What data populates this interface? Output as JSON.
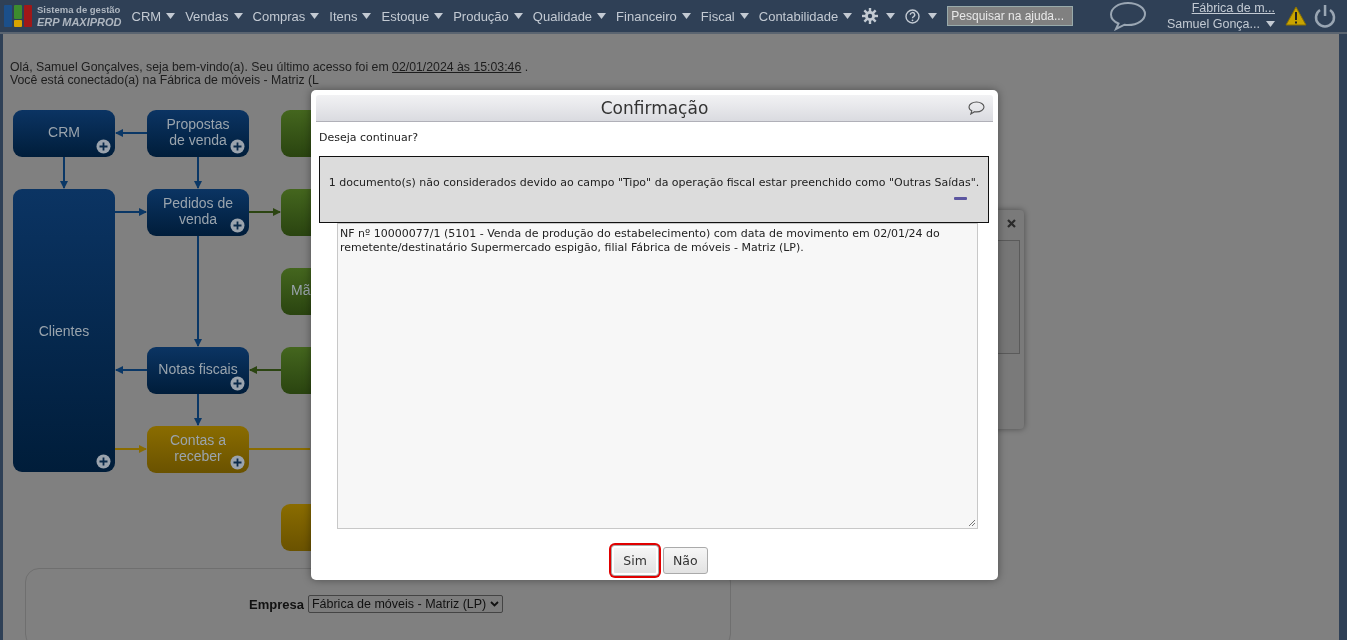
{
  "navbar": {
    "brand_top": "Sistema de gestão",
    "brand_bottom": "ERP MAXIPROD",
    "menus": [
      "CRM",
      "Vendas",
      "Compras",
      "Itens",
      "Estoque",
      "Produção",
      "Qualidade",
      "Financeiro",
      "Fiscal",
      "Contabilidade"
    ],
    "search": {
      "placeholder": "Pesquisar na ajuda..."
    },
    "company_link": "Fábrica de m...",
    "user": "Samuel Gonça..."
  },
  "welcome": {
    "line1_prefix": "Olá, Samuel Gonçalves, seja bem-vindo(a). Seu último acesso foi em ",
    "last_access": "02/01/2024 às 15:03:46",
    "line1_suffix": " .",
    "line2": "Você está conectado(a) na Fábrica de móveis - Matriz (L"
  },
  "flowchart": {
    "nodes": [
      {
        "label": "CRM",
        "kind": "sales",
        "plus": true
      },
      {
        "label": "Propostas de venda",
        "kind": "sales",
        "plus": true
      },
      {
        "label": "Clientes",
        "kind": "sales",
        "plus": true
      },
      {
        "label": "Pedidos de venda",
        "kind": "sales",
        "plus": true
      },
      {
        "label": "Notas fiscais",
        "kind": "sales",
        "plus": true
      },
      {
        "label": "Contas a receber",
        "kind": "finance",
        "plus": true
      },
      {
        "kind": "production",
        "plus": false
      },
      {
        "kind": "production",
        "plus": false
      },
      {
        "label": "Mã",
        "kind": "production",
        "plus": false
      },
      {
        "kind": "production",
        "plus": false
      },
      {
        "kind": "finance",
        "plus": false
      }
    ]
  },
  "form": {
    "fields": [
      {
        "label": "Empresa",
        "value": "Fábrica de móveis - Matriz (LP)"
      }
    ]
  },
  "dialog": {
    "title": "Confirmação",
    "question": "Deseja continuar?",
    "notice": "1 documento(s) não considerados devido ao campo \"Tipo\" da operação fiscal estar preenchido como \"Outras Saídas\".",
    "details": "NF nº 10000077/1 (5101 - Venda de produção do estabelecimento) com data de movimento em 02/01/24 do remetente/destinatário Supermercado espigão, filial Fábrica de móveis - Matriz (LP).",
    "buttons": [
      {
        "label": "Sim",
        "highlighted": true
      },
      {
        "label": "Não",
        "highlighted": false
      }
    ]
  }
}
